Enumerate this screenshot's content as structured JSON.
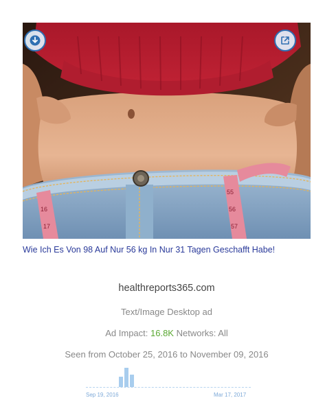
{
  "ad": {
    "headline": "Wie Ich Es Von 98 Auf Nur 56 kg In Nur 31 Tagen Geschafft Habe!",
    "domain": "healthreports365.com",
    "ad_type": "Text/Image Desktop ad",
    "impact_label": "Ad Impact:",
    "impact_value": "16.8K",
    "networks_text": "Networks: All",
    "seen_text": "Seen from October 25, 2016 to November 09, 2016"
  },
  "image": {
    "icons": {
      "download": "download-icon",
      "external": "external-link-icon"
    }
  },
  "timeline": {
    "start_label": "Sep 19, 2016",
    "end_label": "Mar 17, 2017",
    "activity": [
      0.55,
      1.0,
      0.65
    ]
  },
  "colors": {
    "headline": "#2a3a9a",
    "impact": "#5aa832",
    "timeline": "#a8cdee",
    "button_border": "#2f6fb2"
  }
}
